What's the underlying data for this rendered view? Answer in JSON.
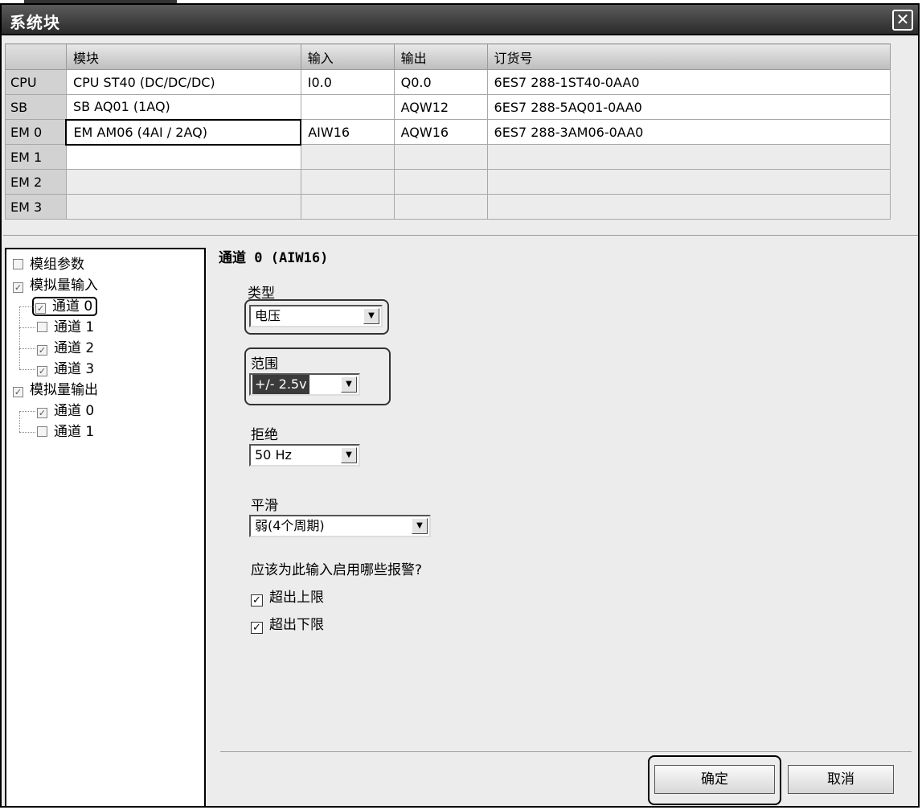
{
  "window": {
    "title": "系统块",
    "close_glyph": "✕"
  },
  "grid": {
    "headers": [
      "",
      "模块",
      "输入",
      "输出",
      "订货号"
    ],
    "rows": [
      {
        "slot": "CPU",
        "module": "CPU ST40 (DC/DC/DC)",
        "input": "I0.0",
        "output": "Q0.0",
        "order": "6ES7 288-1ST40-0AA0"
      },
      {
        "slot": "SB",
        "module": "SB AQ01 (1AQ)",
        "input": "",
        "output": "AQW12",
        "order": "6ES7 288-5AQ01-0AA0"
      },
      {
        "slot": "EM 0",
        "module": "EM AM06 (4AI / 2AQ)",
        "input": "AIW16",
        "output": "AQW16",
        "order": "6ES7 288-3AM06-0AA0"
      },
      {
        "slot": "EM 1",
        "module": "",
        "input": "",
        "output": "",
        "order": ""
      },
      {
        "slot": "EM 2",
        "module": "",
        "input": "",
        "output": "",
        "order": ""
      },
      {
        "slot": "EM 3",
        "module": "",
        "input": "",
        "output": "",
        "order": ""
      }
    ]
  },
  "tree": {
    "items": [
      {
        "label": "模组参数",
        "checked": false
      },
      {
        "label": "模拟量输入",
        "checked": true
      },
      {
        "label": "通道 0",
        "checked": true
      },
      {
        "label": "通道 1",
        "checked": false
      },
      {
        "label": "通道 2",
        "checked": true
      },
      {
        "label": "通道 3",
        "checked": true
      },
      {
        "label": "模拟量输出",
        "checked": true
      },
      {
        "label": "通道 0",
        "checked": true
      },
      {
        "label": "通道 1",
        "checked": false
      }
    ]
  },
  "channel": {
    "title": "通道 0 (AIW16)",
    "type_label": "类型",
    "type_value": "电压",
    "range_label": "范围",
    "range_value": "+/- 2.5v",
    "reject_label": "拒绝",
    "reject_value": "50 Hz",
    "smoothing_label": "平滑",
    "smoothing_value": "弱(4个周期)",
    "alarms_question": "应该为此输入启用哪些报警?",
    "alarm_upper": "超出上限",
    "alarm_lower": "超出下限",
    "alarm_upper_checked": true,
    "alarm_lower_checked": true
  },
  "buttons": {
    "ok": "确定",
    "cancel": "取消"
  },
  "glyphs": {
    "check": "✓",
    "dropdown": "▼"
  }
}
